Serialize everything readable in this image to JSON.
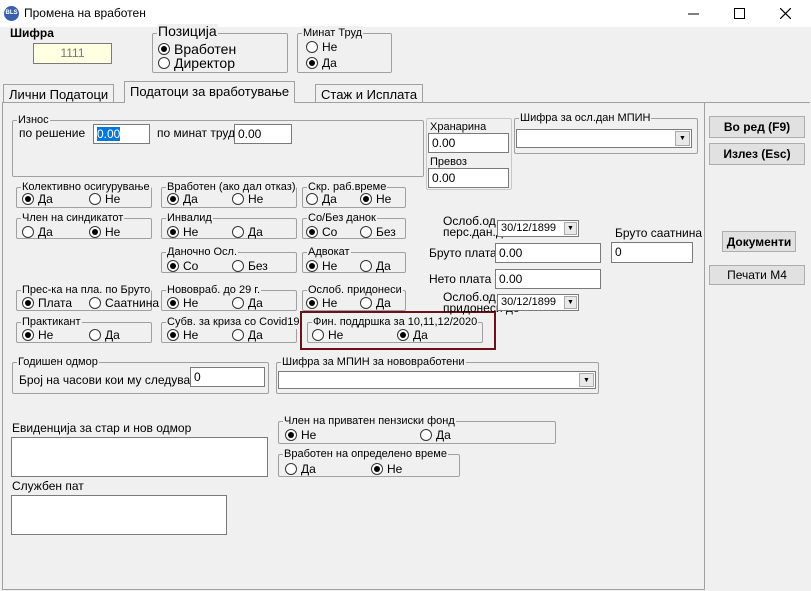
{
  "window": {
    "title": "Промена на вработен",
    "icon": "app-logo-icon"
  },
  "header": {
    "shifra_label": "Шифра",
    "shifra_value": "1111",
    "pozicija": {
      "title": "Позиција",
      "options": [
        "Вработен",
        "Директор"
      ],
      "selected": 0
    },
    "minat_trud": {
      "title": "Минат Труд",
      "options": [
        "Не",
        "Да"
      ],
      "selected": 1
    }
  },
  "tabs": [
    "Лични Податоци",
    "Податоци за вработување",
    "Стаж и Исплата"
  ],
  "active_tab": 1,
  "iznos": {
    "title": "Износ",
    "po_reshenie_label": "по решение",
    "po_reshenie_value": "0.00",
    "po_minat_trud_label": "по минат труд",
    "po_minat_trud_value": "0.00"
  },
  "hranarina": {
    "label": "Хранарина",
    "value": "0.00"
  },
  "prevoz": {
    "label": "Превоз",
    "value": "0.00"
  },
  "mpin_osl": {
    "label": "Шифра за осл.дан МПИН",
    "value": ""
  },
  "groups": {
    "kolektivno": {
      "title": "Колективно осигурување",
      "opt1": "Да",
      "opt2": "Не"
    },
    "vraboten_otkaz": {
      "title": "Вработен (ако дал отказ)",
      "opt1": "Да",
      "opt2": "Не"
    },
    "skr_rab": {
      "title": "Скр. раб.време",
      "opt1": "Да",
      "opt2": "Не"
    },
    "sindikat": {
      "title": "Член на синдикатот",
      "opt1": "Да",
      "opt2": "Не"
    },
    "invalid": {
      "title": "Инвалид",
      "opt1": "Не",
      "opt2": "Да"
    },
    "so_bez_danok": {
      "title": "Со/Без данок",
      "opt1": "Со",
      "opt2": "Без"
    },
    "danochno": {
      "title": "Даночно Осл.",
      "opt1": "Со",
      "opt2": "Без"
    },
    "advokat": {
      "title": "Адвокат",
      "opt1": "Не",
      "opt2": "Да"
    },
    "pres_ka": {
      "title": "Прес-ка на пла. по  Бруто",
      "opt1": "Плата",
      "opt2": "Саатнина"
    },
    "novovrab": {
      "title": "Нововраб. до 29 г.",
      "opt1": "Не",
      "opt2": "Да"
    },
    "osl_pridonesi": {
      "title": "Ослоб. придонеси",
      "opt1": "Не",
      "opt2": "Да"
    },
    "praktikant": {
      "title": "Практикант",
      "opt1": "Не",
      "opt2": "Да"
    },
    "subv_covid": {
      "title": "Субв. за криза со Covid19",
      "opt1": "Не",
      "opt2": "Да"
    },
    "fin_poddrshka": {
      "title": "Фин. поддршка за 10,11,12/2020",
      "opt1": "Не",
      "opt2": "Да"
    }
  },
  "oslob_pers": {
    "label_line1": "Ослоб.од",
    "label_line2": "перс.дан.до",
    "value": "30/12/1899"
  },
  "bruto_plata": {
    "label": "Бруто плата",
    "value": "0.00"
  },
  "neto_plata": {
    "label": "Нето плата",
    "value": "0.00"
  },
  "oslob_prid": {
    "label_line1": "Ослоб.од",
    "label_line2": "придонеси до",
    "value": "30/12/1899"
  },
  "bruto_saatnina": {
    "label": "Бруто саатнина",
    "value": "0"
  },
  "godishen_odmor": {
    "title": "Годишен одмор",
    "label": "Број на часови кои му следуваат:",
    "value": "0"
  },
  "mpin_novovrab": {
    "label": "Шифра за МПИН за нововработени",
    "value": ""
  },
  "evidencija": {
    "label": "Евиденција за стар и нов одмор",
    "value": ""
  },
  "penziski": {
    "title": "Член на приватен пензиски фонд",
    "opt1": "Не",
    "opt2": "Да"
  },
  "opredeleno": {
    "title": "Вработен на определено време",
    "opt1": "Да",
    "opt2": "Не"
  },
  "sluzhben_pat": {
    "label": "Службен пат",
    "value": ""
  },
  "buttons": {
    "ok": "Во ред (F9)",
    "cancel": "Излез (Esc)",
    "dokumenti": "Документи",
    "pechati": "Печати М4"
  }
}
